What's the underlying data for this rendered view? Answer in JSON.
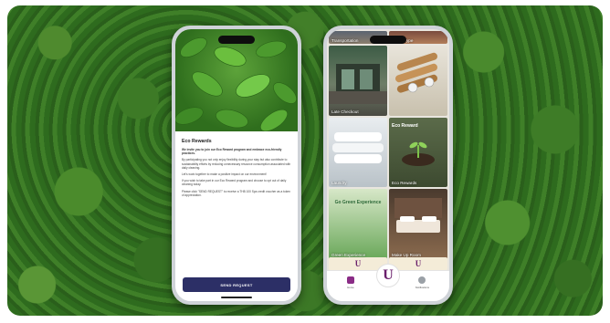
{
  "left_phone": {
    "title": "Eco Rewards",
    "paragraphs": [
      "We invite you to join our Eco Reward program and embrace eco-friendly practices.",
      "By participating you not only enjoy flexibility during your stay but also contribute to sustainability efforts by reducing unnecessary resource consumption associated with daily cleaning.",
      "Let's work together to make a positive impact on our environment!",
      "If you wish to take part in our Eco Reward program and choose to opt out of daily cleaning today.",
      "Please click \"SEND REQUEST\" to receive a THB 100 Spa credit voucher as a token of appreciation."
    ],
    "send_button": "SEND REQUEST"
  },
  "right_phone": {
    "tiles": [
      {
        "label": "Transportation"
      },
      {
        "label": "Room Type"
      },
      {
        "label": "Late Checkout"
      },
      {
        "label": ""
      },
      {
        "label": "Laundry"
      },
      {
        "label": "Eco Rewards"
      },
      {
        "label": "Green Experience"
      },
      {
        "label": "Make Up Room"
      }
    ],
    "eco_tile_heading": "Eco Reward",
    "green_tile_heading": "Go Green Experience",
    "brand_letter": "U",
    "tabs": {
      "home": "Home",
      "notifications": "Notifications"
    }
  },
  "colors": {
    "send_button": "#2c2f66",
    "brand": "#6a1f6b"
  }
}
